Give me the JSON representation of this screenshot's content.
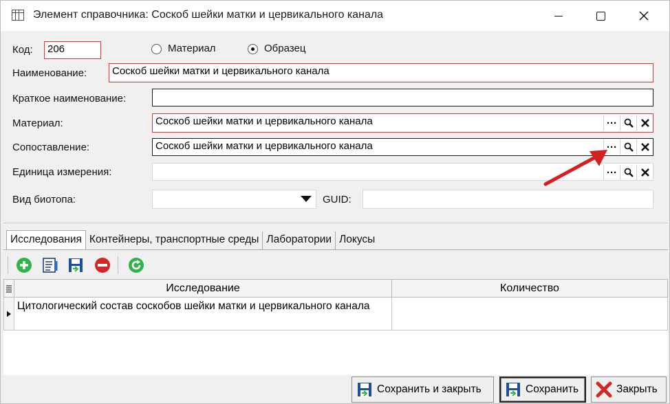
{
  "window": {
    "title": "Элемент справочника: Соскоб шейки матки и цервикального канала",
    "icons": {
      "app": "table-icon",
      "minimize": "minimize-icon",
      "maximize": "maximize-icon",
      "close": "close-icon"
    }
  },
  "form": {
    "code_label": "Код:",
    "code_value": "206",
    "type_options": [
      {
        "label": "Материал",
        "selected": false
      },
      {
        "label": "Образец",
        "selected": true
      }
    ],
    "name_label": "Наименование:",
    "name_value": "Соскоб шейки матки и цервикального канала",
    "short_name_label": "Краткое наименование:",
    "short_name_value": "",
    "material_label": "Материал:",
    "material_value": "Соскоб шейки матки и цервикального канала",
    "mapping_label": "Сопоставление:",
    "mapping_value": "Соскоб шейки матки и цервикального канала",
    "unit_label": "Единица измерения:",
    "unit_value": "",
    "biotope_label": "Вид биотопа:",
    "biotope_value": "",
    "guid_label": "GUID:",
    "guid_value": "",
    "field_buttons": {
      "select": "···",
      "search": "search-icon",
      "clear": "clear-icon"
    }
  },
  "tabs": [
    {
      "label": "Исследования",
      "active": true
    },
    {
      "label": "Контейнеры, транспортные среды",
      "active": false
    },
    {
      "label": "Лаборатории",
      "active": false
    },
    {
      "label": "Локусы",
      "active": false
    }
  ],
  "toolbar": {
    "icons": [
      "add-icon",
      "edit-icon",
      "save-icon",
      "delete-icon",
      "refresh-icon"
    ]
  },
  "grid": {
    "columns": [
      "Исследование",
      "Количество"
    ],
    "rows": [
      {
        "study": "Цитологический состав соскобов шейки матки и цервикального канала",
        "quantity": ""
      }
    ]
  },
  "footer": {
    "save_close_label": "Сохранить и закрыть",
    "save_label": "Сохранить",
    "close_label": "Закрыть"
  },
  "colors": {
    "required_border": "#e03434",
    "annotation_arrow": "#d42020",
    "add_green": "#2fb34a",
    "delete_red": "#d32626"
  }
}
